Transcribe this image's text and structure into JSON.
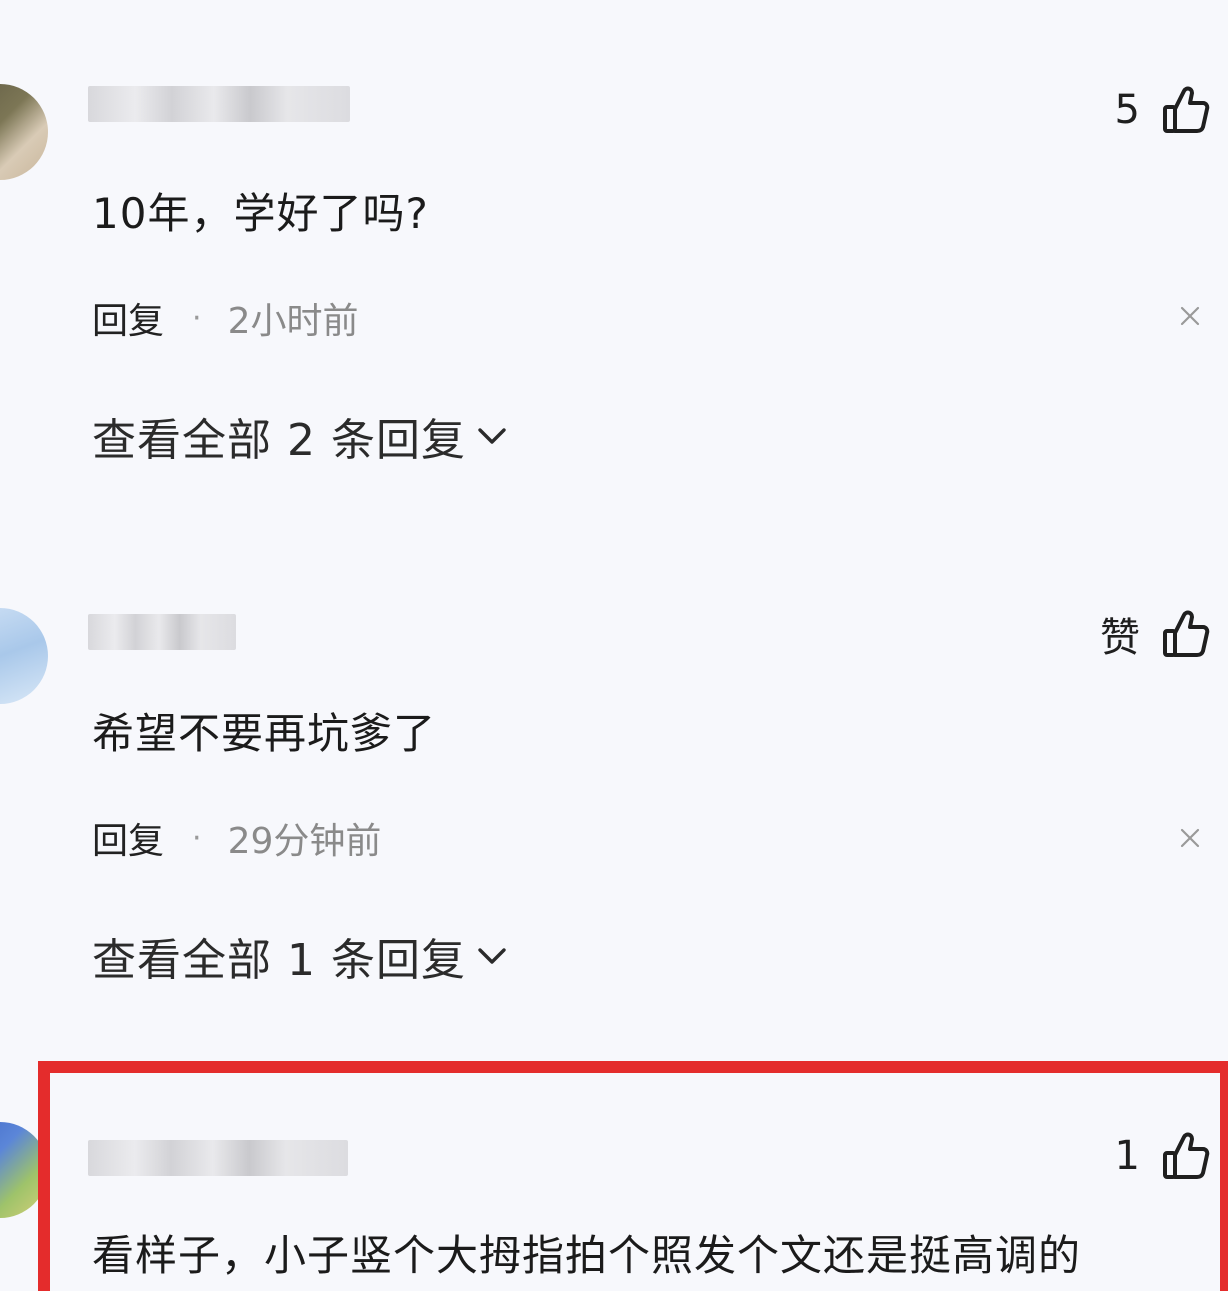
{
  "comments": [
    {
      "content": "10年，学好了吗?",
      "like_label": "5",
      "reply_label": "回复",
      "separator": "·",
      "time": "2小时前",
      "view_replies": "查看全部 2 条回复"
    },
    {
      "content": "希望不要再坑爹了",
      "like_label": "赞",
      "reply_label": "回复",
      "separator": "·",
      "time": "29分钟前",
      "view_replies": "查看全部 1 条回复"
    },
    {
      "content": "看样子，小子竖个大拇指拍个照发个文还是挺高调的",
      "like_label": "1"
    }
  ],
  "icons": {
    "like": "thumbs-up-icon",
    "close": "close-icon",
    "expand": "chevron-down-icon"
  },
  "colors": {
    "background": "#f7f8fc",
    "highlight_border": "#e42c2c",
    "meta_text": "#8a8a8a"
  }
}
